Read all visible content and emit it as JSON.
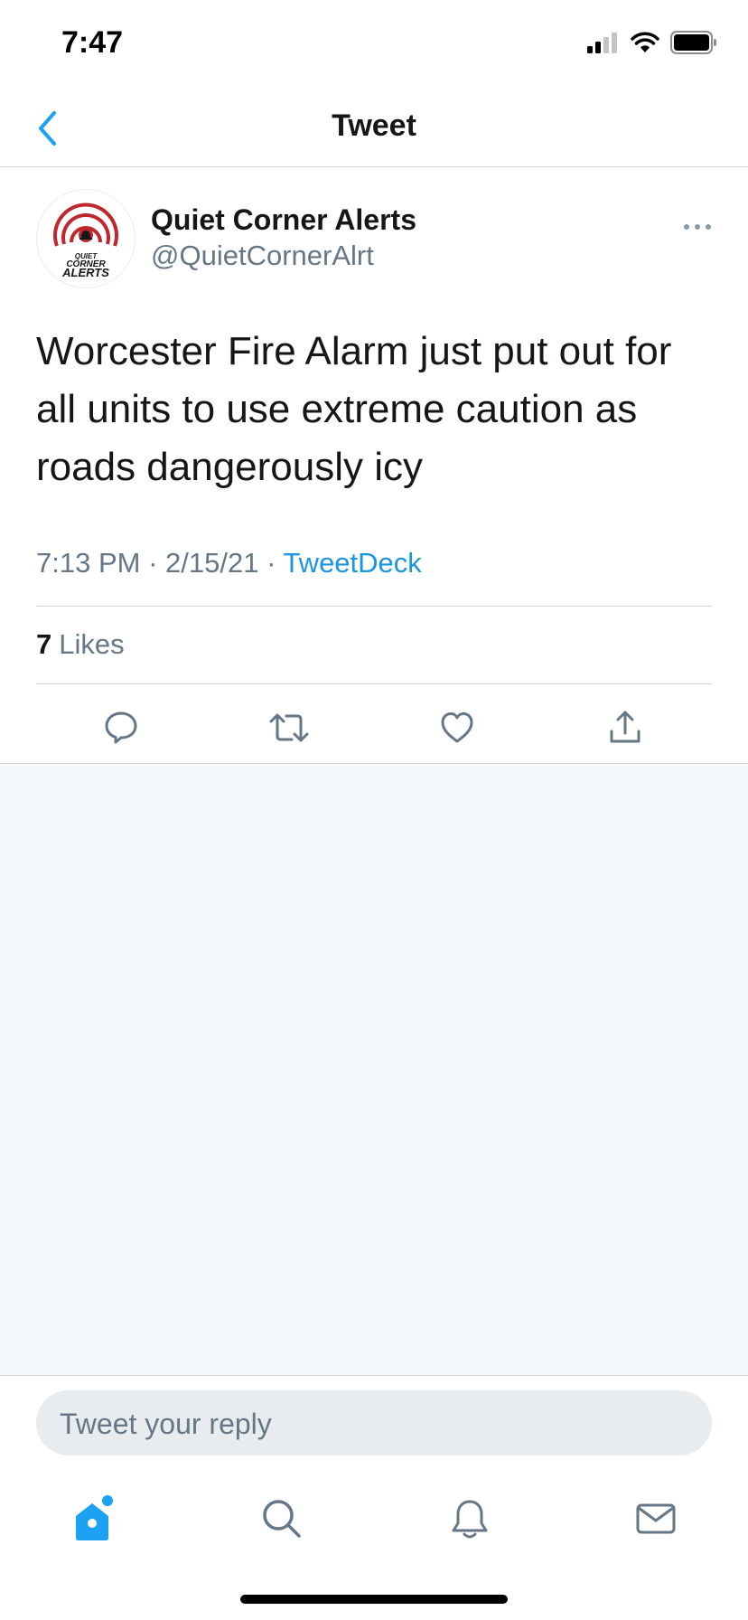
{
  "status_bar": {
    "time": "7:47"
  },
  "navbar": {
    "title": "Tweet"
  },
  "tweet": {
    "display_name": "Quiet Corner Alerts",
    "handle": "@QuietCornerAlrt",
    "avatar_logo_text": "QUIET CORNER ALERTS",
    "text": "Worcester Fire Alarm just put out for all units to use extreme caution as roads dangerously icy",
    "time": "7:13 PM",
    "date": "2/15/21",
    "source": "TweetDeck",
    "separator": " · ",
    "likes_count": "7",
    "likes_label": "Likes"
  },
  "actions": [
    "reply-icon",
    "retweet-icon",
    "like-icon",
    "share-icon"
  ],
  "reply": {
    "placeholder": "Tweet your reply"
  },
  "tabs": [
    "home-icon",
    "search-icon",
    "notifications-icon",
    "messages-icon"
  ],
  "colors": {
    "accent": "#1da1f2",
    "link": "#1b95e0",
    "secondary_text": "#657786",
    "logo_red": "#c0272d"
  }
}
